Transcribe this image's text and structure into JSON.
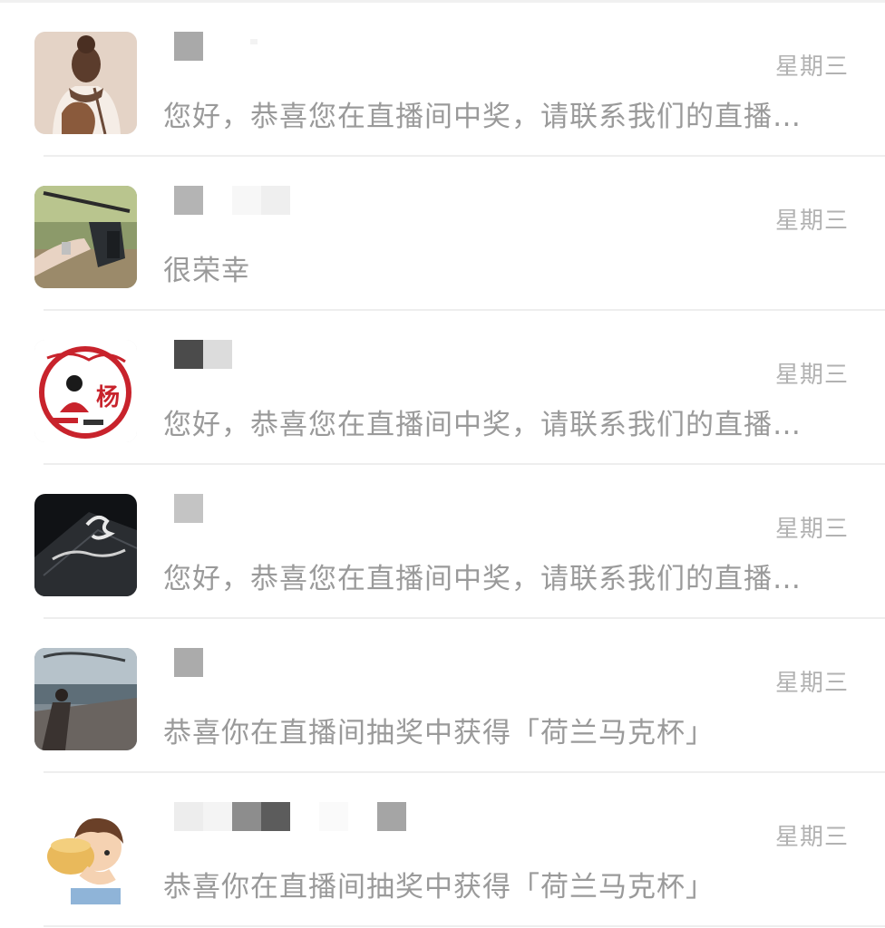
{
  "chats": [
    {
      "avatar_icon": "girl-backpack-avatar-icon",
      "time": "星期三",
      "preview": "您好，恭喜您在直播间中奖，请联系我们的直播…"
    },
    {
      "avatar_icon": "crossbow-hand-avatar-icon",
      "time": "星期三",
      "preview": "很荣幸"
    },
    {
      "avatar_icon": "red-yang-logo-avatar-icon",
      "time": "星期三",
      "preview": "您好，恭喜您在直播间中奖，请联系我们的直播…"
    },
    {
      "avatar_icon": "calligraphy-card-avatar-icon",
      "time": "星期三",
      "preview": "您好，恭喜您在直播间中奖，请联系我们的直播…"
    },
    {
      "avatar_icon": "seaside-pier-avatar-icon",
      "time": "星期三",
      "preview": "恭喜你在直播间抽奖中获得「荷兰马克杯」"
    },
    {
      "avatar_icon": "cartoon-boy-drinking-avatar-icon",
      "time": "星期三",
      "preview": "恭喜你在直播间抽奖中获得「荷兰马克杯」"
    }
  ],
  "colors": {
    "time": "#b2b2b2",
    "preview": "#9a9a9a",
    "divider": "#eeeeee"
  }
}
